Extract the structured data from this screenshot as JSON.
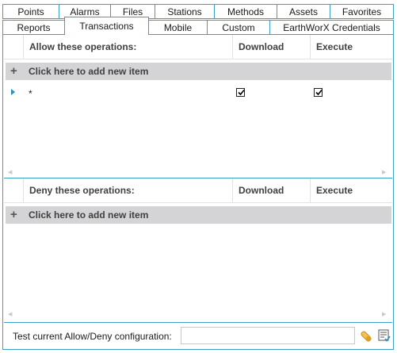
{
  "tabs": {
    "row1": [
      "Points",
      "Alarms",
      "Files",
      "Stations",
      "Methods",
      "Assets",
      "Favorites"
    ],
    "row2": [
      "Reports",
      "Transactions",
      "Mobile",
      "Custom",
      "EarthWorX Credentials"
    ],
    "active": "Transactions"
  },
  "allow_grid": {
    "header": "Allow these operations:",
    "col_download": "Download",
    "col_execute": "Execute",
    "add_label": "Click here to add new item",
    "rows": [
      {
        "operation": "*",
        "download": true,
        "execute": true
      }
    ]
  },
  "deny_grid": {
    "header": "Deny these operations:",
    "col_download": "Download",
    "col_execute": "Execute",
    "add_label": "Click here to add new item"
  },
  "test": {
    "label": "Test current Allow/Deny configuration:",
    "input_value": ""
  },
  "icons": {
    "add": "plus-icon",
    "row_indicator": "row-indicator-icon",
    "test_run": "test-tube-icon",
    "results": "results-list-icon"
  },
  "colors": {
    "accent_border": "#3c9fc4",
    "add_row_bg": "#d4d3d6",
    "row_indicator": "#2b8fbf",
    "test_icon": "#e0a020"
  }
}
